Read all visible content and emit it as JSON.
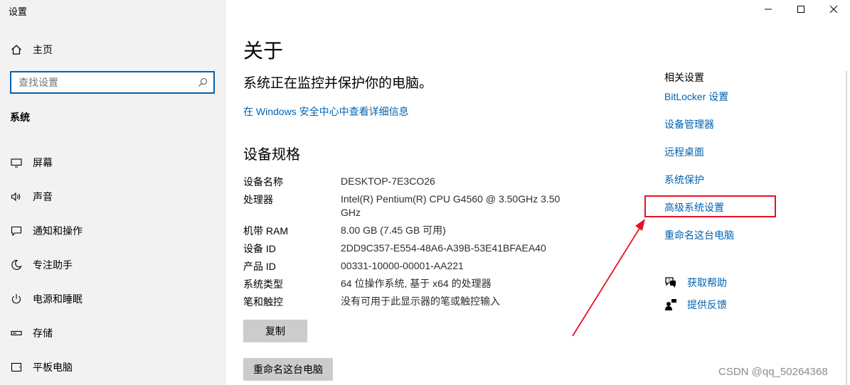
{
  "app": {
    "title": "设置"
  },
  "window_controls": {
    "minimize_icon": "minimize-icon",
    "maximize_icon": "maximize-icon",
    "close_icon": "close-icon"
  },
  "sidebar": {
    "home_label": "主页",
    "search_placeholder": "查找设置",
    "section_label": "系统",
    "items": [
      {
        "label": "屏幕",
        "icon": "display-icon"
      },
      {
        "label": "声音",
        "icon": "sound-icon"
      },
      {
        "label": "通知和操作",
        "icon": "notification-icon"
      },
      {
        "label": "专注助手",
        "icon": "moon-icon"
      },
      {
        "label": "电源和睡眠",
        "icon": "power-icon"
      },
      {
        "label": "存储",
        "icon": "storage-icon"
      },
      {
        "label": "平板电脑",
        "icon": "tablet-icon"
      }
    ]
  },
  "main": {
    "title": "关于",
    "protect_text": "系统正在监控并保护你的电脑。",
    "security_link": "在 Windows 安全中心中查看详细信息",
    "spec_title": "设备规格",
    "specs": [
      {
        "key": "设备名称",
        "value": "DESKTOP-7E3CO26"
      },
      {
        "key": "处理器",
        "value": "Intel(R) Pentium(R) CPU G4560 @ 3.50GHz   3.50 GHz"
      },
      {
        "key": "机带 RAM",
        "value": "8.00 GB (7.45 GB 可用)"
      },
      {
        "key": "设备 ID",
        "value": "2DD9C357-E554-48A6-A39B-53E41BFAEA40"
      },
      {
        "key": "产品 ID",
        "value": "00331-10000-00001-AA221"
      },
      {
        "key": "系统类型",
        "value": "64 位操作系统, 基于 x64 的处理器"
      },
      {
        "key": "笔和触控",
        "value": "没有可用于此显示器的笔或触控输入"
      }
    ],
    "copy_button": "复制",
    "rename_button": "重命名这台电脑"
  },
  "related": {
    "title": "相关设置",
    "links": [
      "BitLocker 设置",
      "设备管理器",
      "远程桌面",
      "系统保护",
      "高级系统设置",
      "重命名这台电脑"
    ],
    "highlighted": "高级系统设置",
    "help_label": "获取帮助",
    "feedback_label": "提供反馈"
  },
  "colors": {
    "accent": "#0063b1",
    "annotation": "#e81123",
    "sidebar_bg": "#f2f2f2",
    "button_bg": "#cccccc"
  },
  "watermark": "CSDN @qq_50264368"
}
